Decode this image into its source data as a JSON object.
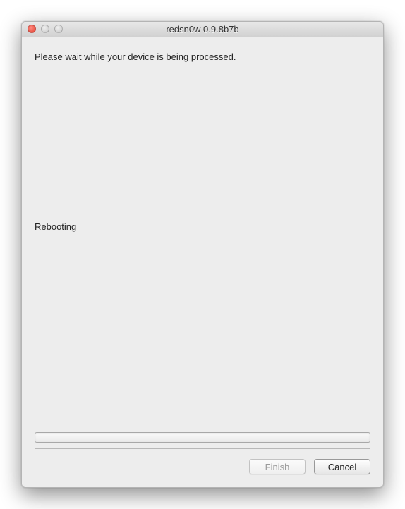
{
  "window": {
    "title": "redsn0w 0.9.8b7b"
  },
  "content": {
    "instruction": "Please wait while your device is being processed.",
    "status": "Rebooting"
  },
  "buttons": {
    "finish": "Finish",
    "cancel": "Cancel"
  }
}
